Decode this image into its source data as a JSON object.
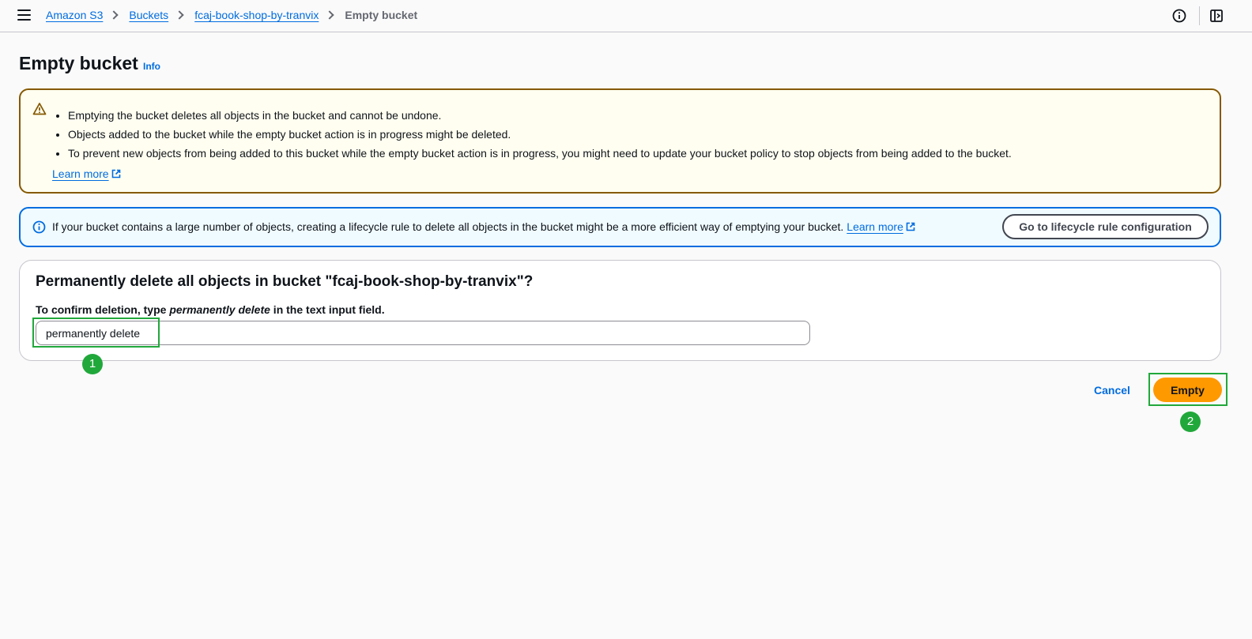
{
  "breadcrumbs": {
    "items": [
      "Amazon S3",
      "Buckets",
      "fcaj-book-shop-by-tranvix"
    ],
    "current": "Empty bucket"
  },
  "page": {
    "title": "Empty bucket",
    "info_link": "Info"
  },
  "warning": {
    "bullets": [
      "Emptying the bucket deletes all objects in the bucket and cannot be undone.",
      "Objects added to the bucket while the empty bucket action is in progress might be deleted.",
      "To prevent new objects from being added to this bucket while the empty bucket action is in progress, you might need to update your bucket policy to stop objects from being added to the bucket."
    ],
    "learn_more": "Learn more"
  },
  "info_alert": {
    "text": "If your bucket contains a large number of objects, creating a lifecycle rule to delete all objects in the bucket might be a more efficient way of emptying your bucket.",
    "learn_more": "Learn more",
    "button_label": "Go to lifecycle rule configuration"
  },
  "confirm": {
    "title": "Permanently delete all objects in bucket \"fcaj-book-shop-by-tranvix\"?",
    "label_prefix": "To confirm deletion, type ",
    "label_phrase": "permanently delete",
    "label_suffix": " in the text input field.",
    "input_value": "permanently delete"
  },
  "actions": {
    "cancel_label": "Cancel",
    "empty_label": "Empty"
  },
  "annotations": {
    "badge_1": "1",
    "badge_2": "2",
    "color": "#21a83b"
  },
  "colors": {
    "link": "#006ce0",
    "primary_button": "#ff9900",
    "warning_border": "#855900",
    "warning_bg": "#fffef0",
    "info_border": "#006ce0",
    "info_bg": "#f0fbff"
  },
  "icons": [
    "menu-icon",
    "info-circle-icon",
    "split-panel-icon",
    "warning-icon",
    "external-link-icon"
  ]
}
